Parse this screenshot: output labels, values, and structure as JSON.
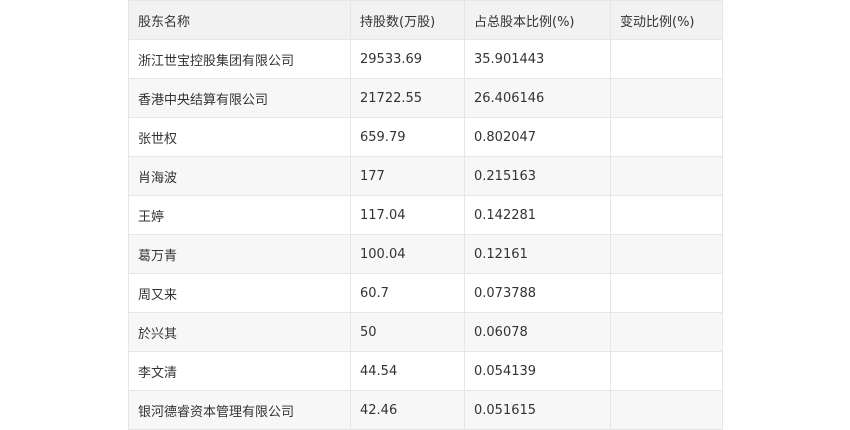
{
  "table": {
    "headers": [
      "股东名称",
      "持股数(万股)",
      "占总股本比例(%)",
      "变动比例(%)"
    ],
    "rows": [
      [
        "浙江世宝控股集团有限公司",
        "29533.69",
        "35.901443",
        ""
      ],
      [
        "香港中央结算有限公司",
        "21722.55",
        "26.406146",
        ""
      ],
      [
        "张世权",
        "659.79",
        "0.802047",
        ""
      ],
      [
        "肖海波",
        "177",
        "0.215163",
        ""
      ],
      [
        "王婷",
        "117.04",
        "0.142281",
        ""
      ],
      [
        "葛万青",
        "100.04",
        "0.12161",
        ""
      ],
      [
        "周又来",
        "60.7",
        "0.073788",
        ""
      ],
      [
        "於兴其",
        "50",
        "0.06078",
        ""
      ],
      [
        "李文清",
        "44.54",
        "0.054139",
        ""
      ],
      [
        "银河德睿资本管理有限公司",
        "42.46",
        "0.051615",
        ""
      ]
    ]
  }
}
